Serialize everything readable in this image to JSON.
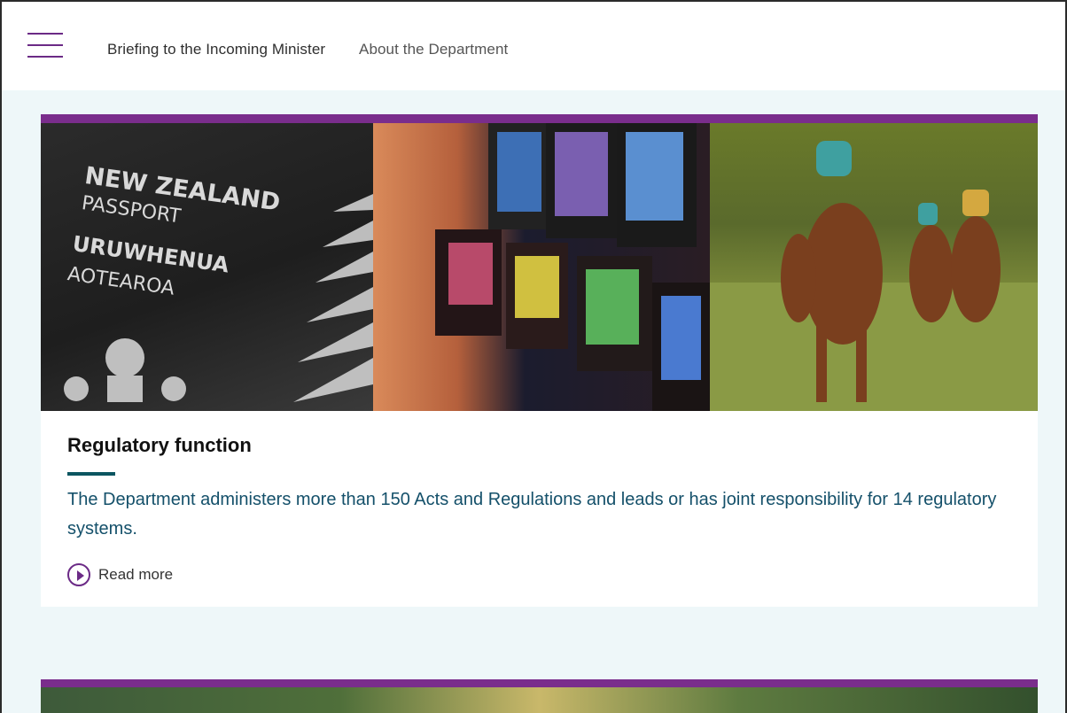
{
  "header": {
    "nav": [
      {
        "label": "Briefing to the Incoming Minister"
      },
      {
        "label": "About the Department"
      }
    ]
  },
  "card": {
    "images": {
      "passport": {
        "lines": [
          "NEW ZEALAND",
          "PASSPORT",
          "URUWHENUA",
          "AOTEAROA"
        ]
      },
      "slot_machines": {},
      "horse_racing": {}
    },
    "title": "Regulatory function",
    "description": "The Department administers more than 150 Acts and Regulations and leads or has joint responsibility for 14 regulatory systems.",
    "read_more": "Read more"
  },
  "colors": {
    "accent_purple": "#7a2d8c",
    "underline_teal": "#0b5560",
    "body_text": "#14506a",
    "page_bg": "#eef7f9"
  }
}
